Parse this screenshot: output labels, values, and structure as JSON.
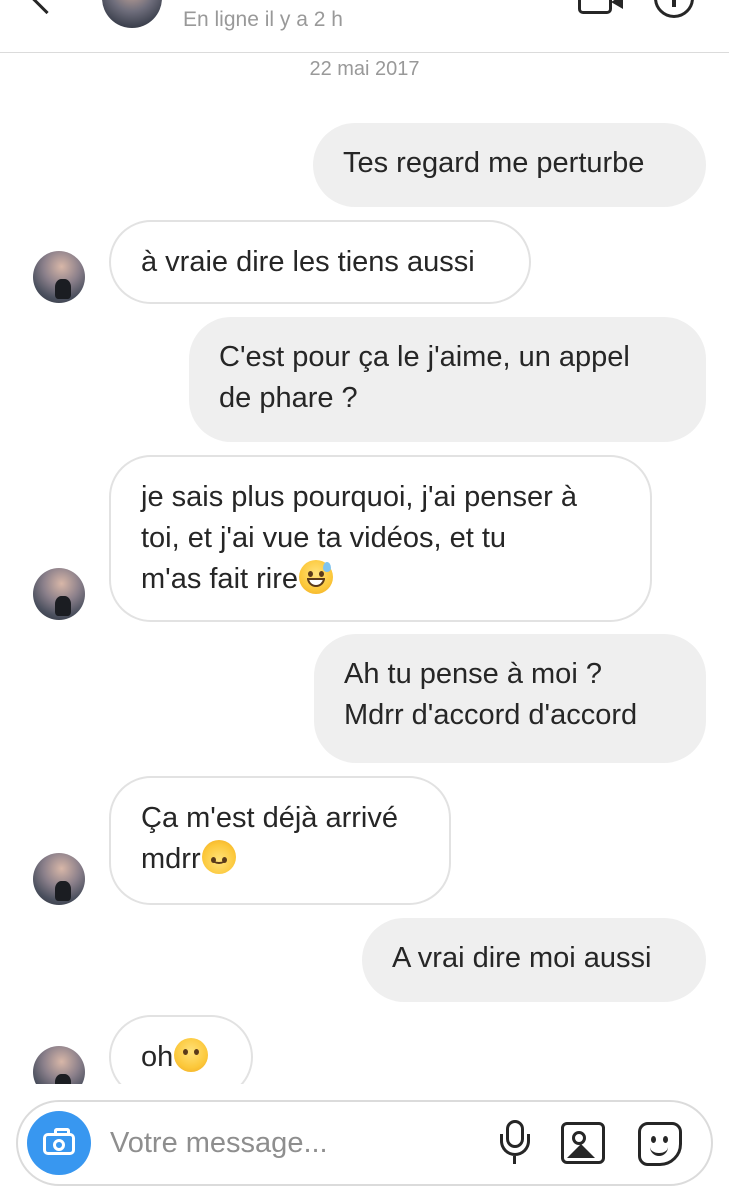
{
  "header": {
    "status": "En ligne il y a 2 h"
  },
  "conversation": {
    "date": "22 mai 2017",
    "messages": [
      {
        "from": "me",
        "text": "Tes regard me perturbe"
      },
      {
        "from": "them",
        "text": "à vraie dire les tiens aussi"
      },
      {
        "from": "me",
        "lines": [
          "C'est pour ça le j'aime, un appel",
          "de phare ?"
        ]
      },
      {
        "from": "them",
        "lines": [
          "je sais plus pourquoi, j'ai penser à",
          "toi, et j'ai vue ta vidéos, et tu",
          "m'as fait rire"
        ],
        "emoji": "grinning-sweat-emoji"
      },
      {
        "from": "me",
        "lines": [
          "Ah tu pense à moi ?",
          "Mdrr d'accord d'accord"
        ]
      },
      {
        "from": "them",
        "lines": [
          "Ça m'est déjà arrivé",
          "mdrr"
        ],
        "emoji": "upside-down-face-emoji"
      },
      {
        "from": "me",
        "text": "A vrai dire moi aussi"
      },
      {
        "from": "them",
        "text": "oh",
        "emoji": "face-without-mouth-emoji"
      }
    ]
  },
  "composer": {
    "placeholder": "Votre message..."
  },
  "icons": {
    "back": "chevron-left-icon",
    "video": "video-call-icon",
    "info": "info-icon",
    "camera": "camera-icon",
    "mic": "microphone-icon",
    "gallery": "gallery-icon",
    "sticker": "sticker-icon"
  },
  "colors": {
    "sent_bubble": "#efefef",
    "received_border": "#e2e2e2",
    "camera_button": "#3897f0",
    "muted_text": "#999999"
  }
}
